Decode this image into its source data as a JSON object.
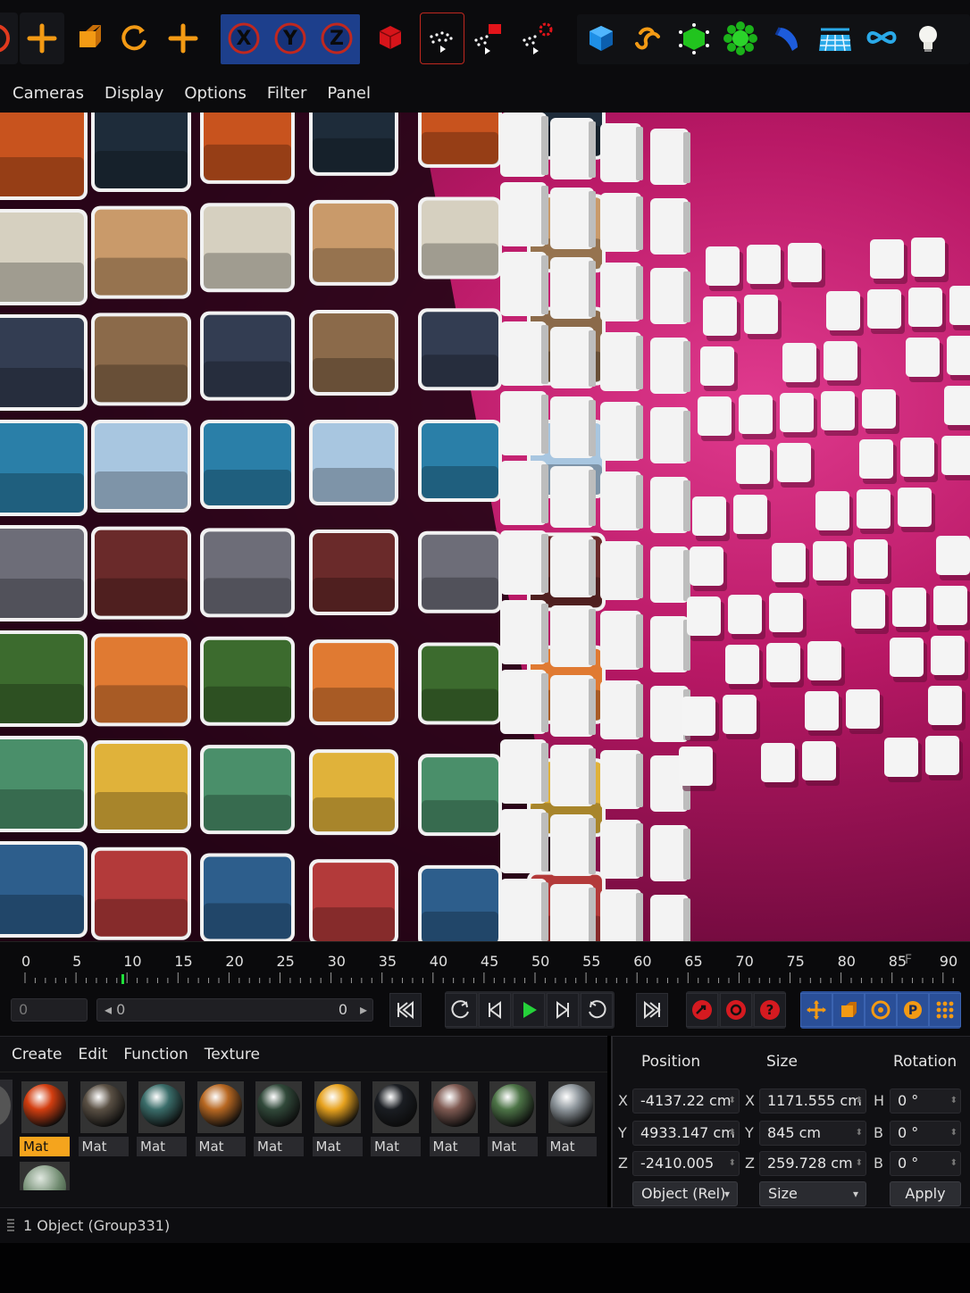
{
  "menu": {
    "cameras": "Cameras",
    "display": "Display",
    "options": "Options",
    "filter": "Filter",
    "panel": "Panel"
  },
  "toolbar": {
    "axis_x": "X",
    "axis_y": "Y",
    "axis_z": "Z"
  },
  "timeline": {
    "ticks": [
      "0",
      "5",
      "10",
      "15",
      "20",
      "25",
      "30",
      "35",
      "40",
      "45",
      "50",
      "55",
      "60",
      "65",
      "70",
      "75",
      "80",
      "85",
      "90"
    ],
    "end_unit": "F",
    "current_frame": 10
  },
  "transport": {
    "frame_field": "0",
    "slider_value": "0",
    "slider_left_text": "0"
  },
  "material_manager": {
    "menu": {
      "create": "Create",
      "edit": "Edit",
      "function": "Function",
      "texture": "Texture"
    },
    "materials": [
      {
        "label": "Mat",
        "color": "#d33e10"
      },
      {
        "label": "Mat",
        "color": "#5a5044"
      },
      {
        "label": "Mat",
        "color": "#3a6d6a"
      },
      {
        "label": "Mat",
        "color": "#b86822"
      },
      {
        "label": "Mat",
        "color": "#31493a"
      },
      {
        "label": "Mat",
        "color": "#e7a21e"
      },
      {
        "label": "Mat",
        "color": "#1a1d22"
      },
      {
        "label": "Mat",
        "color": "#7f5a52"
      },
      {
        "label": "Mat",
        "color": "#4d7447"
      },
      {
        "label": "Mat",
        "color": "#8f979d"
      }
    ]
  },
  "attributes": {
    "headers": {
      "position": "Position",
      "size": "Size",
      "rotation": "Rotation"
    },
    "position": {
      "x": "-4137.22 cm",
      "y": "4933.147 cm",
      "z": "-2410.005 cm"
    },
    "size": {
      "x": "1171.555 cm",
      "y": "845 cm",
      "z": "259.728 cm"
    },
    "rotation": {
      "h": "0 °",
      "b1": "0 °",
      "b2": "0 °"
    },
    "labels": {
      "x": "X",
      "y": "Y",
      "z": "Z",
      "h": "H",
      "b": "B"
    },
    "coord_mode": "Object (Rel)",
    "size_mode": "Size",
    "apply": "Apply"
  },
  "status": {
    "text": "1 Object (Group331)"
  }
}
